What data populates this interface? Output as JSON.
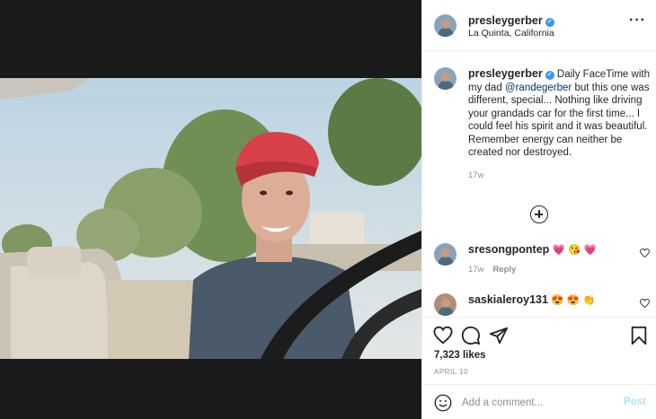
{
  "post": {
    "username": "presleygerber",
    "location": "La Quinta, California",
    "caption": {
      "username": "presleygerber",
      "text_before": " Daily FaceTime with my dad ",
      "mention": "@randegerber",
      "text_after": " but this one was different, special... Nothing like driving your grandads car for the first time... I could feel his spirit and it was beautiful. Remember energy can neither be created nor destroyed.",
      "time": "17w"
    },
    "comments": [
      {
        "username": "sresongpontep",
        "text": "💗 😘 💗",
        "time": "17w",
        "reply_label": "Reply"
      },
      {
        "username": "saskialeroy131",
        "text": "😍 😍 👏"
      }
    ],
    "likes": "7,323 likes",
    "date": "APRIL 10",
    "add_comment": {
      "placeholder": "Add a comment...",
      "post_label": "Post"
    }
  },
  "icons": {
    "verified": "verified-badge-icon",
    "more": "more-options-icon",
    "load_more": "plus-circle-icon",
    "like": "heart-icon",
    "comment": "comment-icon",
    "share": "share-icon",
    "save": "bookmark-icon",
    "emoji": "emoji-icon"
  },
  "colors": {
    "link": "#00376b",
    "verified": "#3897f0",
    "muted": "#8e8e8e",
    "post_disabled": "#b2dffc"
  }
}
